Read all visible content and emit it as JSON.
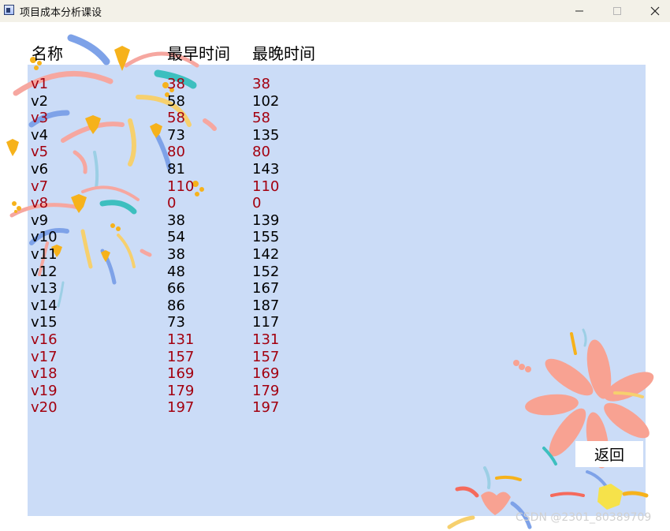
{
  "window": {
    "title": "项目成本分析课设",
    "controls": {
      "minimize_icon": "minimize-icon",
      "maximize_icon": "maximize-icon",
      "close_icon": "close-icon"
    }
  },
  "table": {
    "headers": {
      "name": "名称",
      "earliest": "最早时间",
      "latest": "最晚时间"
    },
    "rows": [
      {
        "name": "v1",
        "earliest": "38",
        "latest": "38",
        "critical": true
      },
      {
        "name": "v2",
        "earliest": "58",
        "latest": "102",
        "critical": false
      },
      {
        "name": "v3",
        "earliest": "58",
        "latest": "58",
        "critical": true
      },
      {
        "name": "v4",
        "earliest": "73",
        "latest": "135",
        "critical": false
      },
      {
        "name": "v5",
        "earliest": "80",
        "latest": "80",
        "critical": true
      },
      {
        "name": "v6",
        "earliest": "81",
        "latest": "143",
        "critical": false
      },
      {
        "name": "v7",
        "earliest": "110",
        "latest": "110",
        "critical": true
      },
      {
        "name": "v8",
        "earliest": "0",
        "latest": "0",
        "critical": true
      },
      {
        "name": "v9",
        "earliest": "38",
        "latest": "139",
        "critical": false
      },
      {
        "name": "v10",
        "earliest": "54",
        "latest": "155",
        "critical": false
      },
      {
        "name": "v11",
        "earliest": "38",
        "latest": "142",
        "critical": false
      },
      {
        "name": "v12",
        "earliest": "48",
        "latest": "152",
        "critical": false
      },
      {
        "name": "v13",
        "earliest": "66",
        "latest": "167",
        "critical": false
      },
      {
        "name": "v14",
        "earliest": "86",
        "latest": "187",
        "critical": false
      },
      {
        "name": "v15",
        "earliest": "73",
        "latest": "117",
        "critical": false
      },
      {
        "name": "v16",
        "earliest": "131",
        "latest": "131",
        "critical": true
      },
      {
        "name": "v17",
        "earliest": "157",
        "latest": "157",
        "critical": true
      },
      {
        "name": "v18",
        "earliest": "169",
        "latest": "169",
        "critical": true
      },
      {
        "name": "v19",
        "earliest": "179",
        "latest": "179",
        "critical": true
      },
      {
        "name": "v20",
        "earliest": "197",
        "latest": "197",
        "critical": true
      }
    ]
  },
  "return_button": {
    "label": "返回"
  },
  "watermark": "CSDN @2301_80389709",
  "colors": {
    "panel_bg": "#cbdcf7",
    "critical_text": "#a3000f",
    "normal_text": "#000000",
    "titlebar_bg": "#f3f1e8"
  }
}
